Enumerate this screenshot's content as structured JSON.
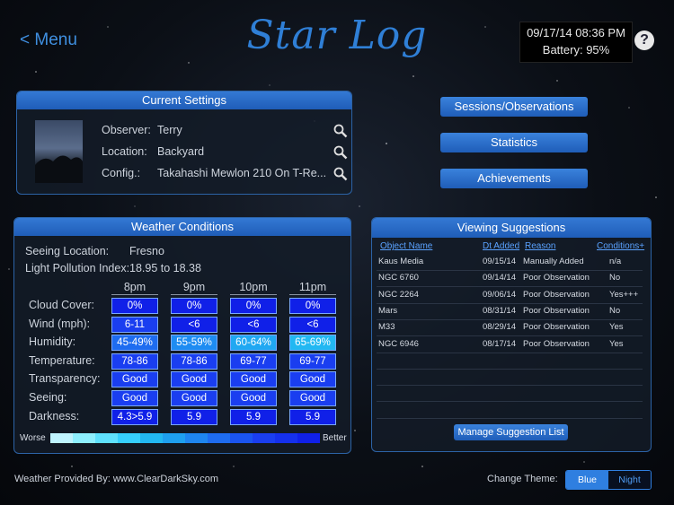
{
  "header": {
    "menu_label": "< Menu",
    "title": "Star Log",
    "datetime": "09/17/14 08:36 PM",
    "battery": "Battery: 95%",
    "help_label": "?"
  },
  "current_settings": {
    "title": "Current Settings",
    "rows": [
      {
        "label": "Observer:",
        "value": "Terry"
      },
      {
        "label": "Location:",
        "value": "Backyard"
      },
      {
        "label": "Config.:",
        "value": "Takahashi Mewlon 210 On T-Re..."
      }
    ]
  },
  "nav": {
    "sessions": "Sessions/Observations",
    "statistics": "Statistics",
    "achievements": "Achievements"
  },
  "weather": {
    "title": "Weather Conditions",
    "seeing_location_label": "Seeing Location:",
    "seeing_location": "Fresno",
    "light_pollution_label": "Light Pollution Index:",
    "light_pollution": "18.95 to 18.38",
    "hours": [
      "8pm",
      "9pm",
      "10pm",
      "11pm"
    ],
    "rows": [
      {
        "label": "Cloud Cover:",
        "values": [
          "0%",
          "0%",
          "0%",
          "0%"
        ],
        "colors": [
          "#1020e8",
          "#1020e8",
          "#1020e8",
          "#1020e8"
        ]
      },
      {
        "label": "Wind (mph):",
        "values": [
          "6-11",
          "<6",
          "<6",
          "<6"
        ],
        "colors": [
          "#1a3ef0",
          "#1020e8",
          "#1020e8",
          "#1020e8"
        ]
      },
      {
        "label": "Humidity:",
        "values": [
          "45-49%",
          "55-59%",
          "60-64%",
          "65-69%"
        ],
        "colors": [
          "#1e6cf0",
          "#1e8cf2",
          "#20a8f2",
          "#22b8f2"
        ]
      },
      {
        "label": "Temperature:",
        "values": [
          "78-86",
          "78-86",
          "69-77",
          "69-77"
        ],
        "colors": [
          "#1a3ef0",
          "#1a3ef0",
          "#1a3ef0",
          "#1a3ef0"
        ]
      },
      {
        "label": "Transparency:",
        "values": [
          "Good",
          "Good",
          "Good",
          "Good"
        ],
        "colors": [
          "#1a3ef0",
          "#1a3ef0",
          "#1a3ef0",
          "#1a3ef0"
        ]
      },
      {
        "label": "Seeing:",
        "values": [
          "Good",
          "Good",
          "Good",
          "Good"
        ],
        "colors": [
          "#1a3ef0",
          "#1a3ef0",
          "#1a3ef0",
          "#1a3ef0"
        ]
      },
      {
        "label": "Darkness:",
        "values": [
          "4.3>5.9",
          "5.9",
          "5.9",
          "5.9"
        ],
        "colors": [
          "#1020e8",
          "#1020e8",
          "#1020e8",
          "#1020e8"
        ]
      }
    ],
    "scale_worse": "Worse",
    "scale_better": "Better",
    "scale_colors": [
      "#bff4ff",
      "#8ef0ff",
      "#5fe2ff",
      "#36d0ff",
      "#22b8f2",
      "#1ea0f0",
      "#1e86f0",
      "#1e6cf0",
      "#1a54f0",
      "#1a3ef0",
      "#1530ec",
      "#1020e8"
    ]
  },
  "suggestions": {
    "title": "Viewing Suggestions",
    "headers": {
      "name": "Object Name",
      "date": "Dt Added",
      "reason": "Reason",
      "conditions": "Conditions+"
    },
    "rows": [
      {
        "name": "Kaus Media",
        "date": "09/15/14",
        "reason": "Manually Added",
        "conditions": "n/a"
      },
      {
        "name": "NGC 6760",
        "date": "09/14/14",
        "reason": "Poor Observation",
        "conditions": "No"
      },
      {
        "name": "NGC 2264",
        "date": "09/06/14",
        "reason": "Poor Observation",
        "conditions": "Yes+++"
      },
      {
        "name": "Mars",
        "date": "08/31/14",
        "reason": "Poor Observation",
        "conditions": "No"
      },
      {
        "name": "M33",
        "date": "08/29/14",
        "reason": "Poor Observation",
        "conditions": "Yes"
      },
      {
        "name": "NGC 6946",
        "date": "08/17/14",
        "reason": "Poor Observation",
        "conditions": "Yes"
      }
    ],
    "manage_label": "Manage Suggestion List"
  },
  "footer": {
    "weather_credit": "Weather Provided By: www.ClearDarkSky.com",
    "theme_label": "Change Theme:",
    "theme_blue": "Blue",
    "theme_night": "Night"
  }
}
